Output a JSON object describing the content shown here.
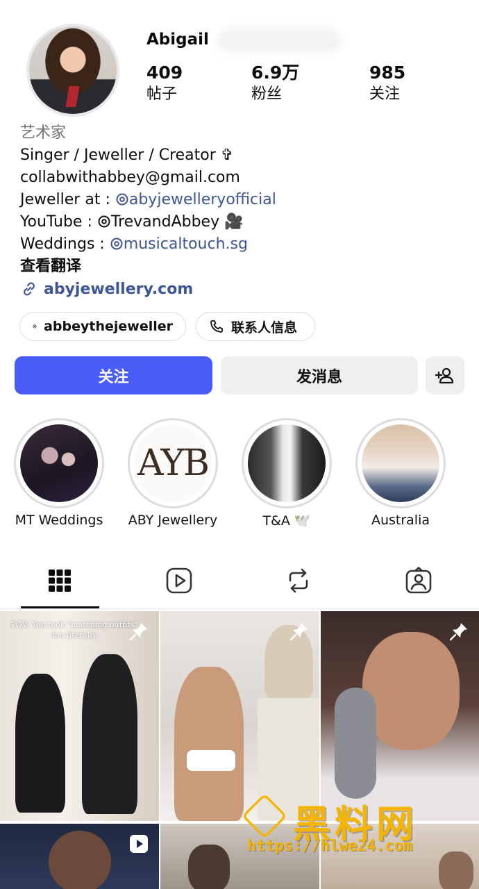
{
  "profile": {
    "username": "Abigail",
    "stats": {
      "posts": {
        "value": "409",
        "label": "帖子"
      },
      "followers": {
        "value": "6.9万",
        "label": "粉丝"
      },
      "following": {
        "value": "985",
        "label": "关注"
      }
    },
    "category": "艺术家",
    "bio": {
      "line1": "Singer / Jeweller / Creator ✞",
      "line2": "collabwithabbey@gmail.com",
      "line3_prefix": "Jeweller at : ",
      "line3_link": "abyjewelleryofficial",
      "line4_prefix": "YouTube : ",
      "line4_handle": "TrevandAbbey 🎥",
      "line5_prefix": "Weddings : ",
      "line5_link": "musicaltouch.sg",
      "translate": "查看翻译"
    },
    "website": "abyjewellery.com"
  },
  "pills": {
    "threads": "abbeythejeweller",
    "contact": "联系人信息"
  },
  "actions": {
    "follow": "关注",
    "message": "发消息"
  },
  "highlights": [
    {
      "label": "MT Weddings"
    },
    {
      "label": "ABY Jewellery",
      "logo_text": "AYB"
    },
    {
      "label": "T&A 🕊️"
    },
    {
      "label": "Australia"
    }
  ],
  "tabs": [
    "grid-icon",
    "reels-icon",
    "reposts-icon",
    "tagged-icon"
  ],
  "posts": {
    "p1_caption": "POV: You took \"matching outfits\" too literally"
  },
  "watermark": {
    "text": "黑料网",
    "url": "https://hlwe24.com"
  },
  "colors": {
    "accent": "#4a5df9",
    "link": "#3e5596",
    "watermark": "#f5b400"
  }
}
